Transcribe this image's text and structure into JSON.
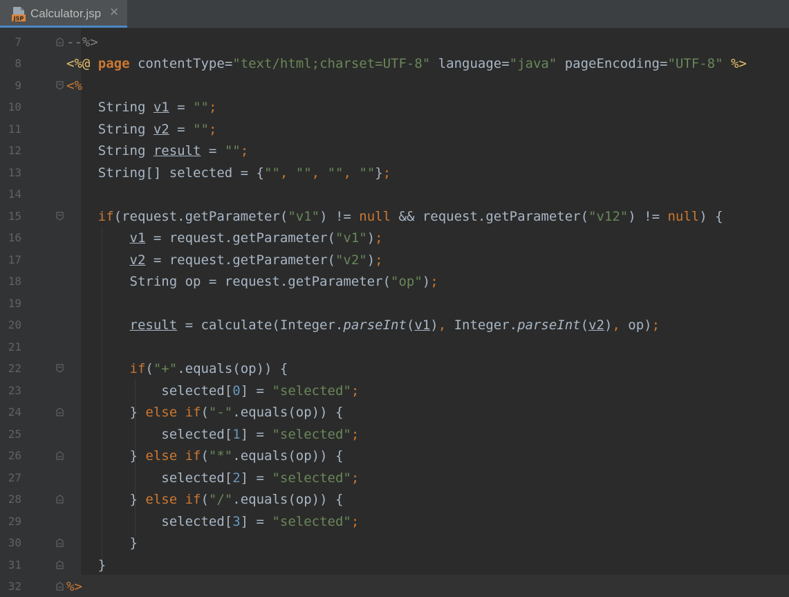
{
  "tab": {
    "label": "Calculator.jsp",
    "icon": "jsp-file-icon",
    "icon_text": "JSP"
  },
  "editor": {
    "lines": [
      {
        "n": "7",
        "text": "--%>"
      },
      {
        "n": "8",
        "text": "<%@ page contentType=\"text/html;charset=UTF-8\" language=\"java\" pageEncoding=\"UTF-8\" %>"
      },
      {
        "n": "9",
        "text": "<%"
      },
      {
        "n": "10",
        "text": "    String v1 = \"\";"
      },
      {
        "n": "11",
        "text": "    String v2 = \"\";"
      },
      {
        "n": "12",
        "text": "    String result = \"\";"
      },
      {
        "n": "13",
        "text": "    String[] selected = {\"\", \"\", \"\", \"\"};"
      },
      {
        "n": "14",
        "text": ""
      },
      {
        "n": "15",
        "text": "    if(request.getParameter(\"v1\") != null && request.getParameter(\"v12\") != null) {"
      },
      {
        "n": "16",
        "text": "        v1 = request.getParameter(\"v1\");"
      },
      {
        "n": "17",
        "text": "        v2 = request.getParameter(\"v2\");"
      },
      {
        "n": "18",
        "text": "        String op = request.getParameter(\"op\");"
      },
      {
        "n": "19",
        "text": ""
      },
      {
        "n": "20",
        "text": "        result = calculate(Integer.parseInt(v1), Integer.parseInt(v2), op);"
      },
      {
        "n": "21",
        "text": ""
      },
      {
        "n": "22",
        "text": "        if(\"+\".equals(op)) {"
      },
      {
        "n": "23",
        "text": "            selected[0] = \"selected\";"
      },
      {
        "n": "24",
        "text": "        } else if(\"-\".equals(op)) {"
      },
      {
        "n": "25",
        "text": "            selected[1] = \"selected\";"
      },
      {
        "n": "26",
        "text": "        } else if(\"*\".equals(op)) {"
      },
      {
        "n": "27",
        "text": "            selected[2] = \"selected\";"
      },
      {
        "n": "28",
        "text": "        } else if(\"/\".equals(op)) {"
      },
      {
        "n": "29",
        "text": "            selected[3] = \"selected\";"
      },
      {
        "n": "30",
        "text": "        }"
      },
      {
        "n": "31",
        "text": "    }"
      },
      {
        "n": "32",
        "text": "%>"
      }
    ]
  },
  "colors": {
    "background": "#2b2b2b",
    "gutter": "#313335",
    "keyword": "#cc7832",
    "string": "#6a8759",
    "number": "#6897bb",
    "text": "#a9b7c6",
    "jsp_tag": "#e8bf6a",
    "tab_underline": "#4a88c7"
  }
}
